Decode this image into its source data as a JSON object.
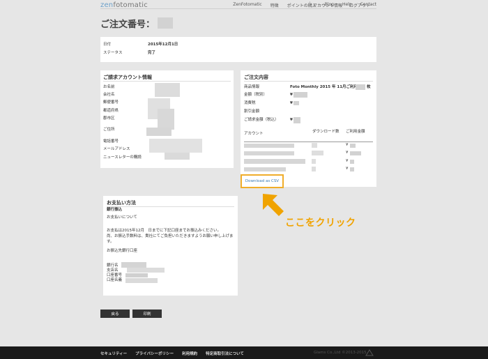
{
  "brand": {
    "prefix": "zen",
    "rest": "fotomatic"
  },
  "nav": [
    "ZenFotomatic",
    "特徴",
    "ポイントの購入",
    "Blog",
    "Help",
    "Contact"
  ],
  "account_nav": [
    "アカウント情報",
    "ログアウト"
  ],
  "page_title": "ご注文番号：",
  "order_summary": {
    "date_label": "日付",
    "date_value": "2015年12月1日",
    "status_label": "ステータス",
    "status_value": "完了"
  },
  "billing": {
    "title": "ご請求アカウント情報",
    "labels": [
      "お名前",
      "会社名",
      "郵便番号",
      "都道府県",
      "郡市区",
      "ご住所",
      "電話番号",
      "メールアドレス",
      "ニュースレターの購読"
    ]
  },
  "order_contents": {
    "title": "ご注文内容",
    "rows": [
      {
        "label": "商品情報",
        "value": "Foto Monthly 2015 年 11月ご利用分",
        "suffix": "枚"
      },
      {
        "label": "金額（税別）",
        "value": "¥"
      },
      {
        "label": "消費税",
        "value": "¥"
      },
      {
        "label": "割引金額",
        "value": ""
      },
      {
        "label": "ご請求金額（税込）",
        "value": "¥"
      }
    ],
    "table_headers": [
      "アカウント",
      "ダウンロード数",
      "ご利用金額"
    ],
    "yen": "¥",
    "download_label": "Download as CSV"
  },
  "payment": {
    "title": "お支払い方法",
    "method": "銀行振込",
    "about": "お支払いについて",
    "note_line1": "お支払は2015年12月　日までに下記口座までお振込みください。",
    "note_line2": "尚、お振込手数料は、貴社にてご負担いただきますようお願い申し上げます。",
    "bank_heading": "お振込先銀行口座",
    "bank_labels": [
      "銀行名",
      "支店名",
      "口座番号",
      "口座名義"
    ]
  },
  "annotation": {
    "click_here": "ここをクリック",
    "arrow_color": "#f0a300"
  },
  "buttons": {
    "back": "戻る",
    "print": "印刷"
  },
  "footer": {
    "links": [
      "セキュリティー",
      "プライバシーポリシー",
      "利用規約",
      "特定商取引法について"
    ],
    "copyright": "Glams Co.,Ltd ©2013-2015"
  }
}
